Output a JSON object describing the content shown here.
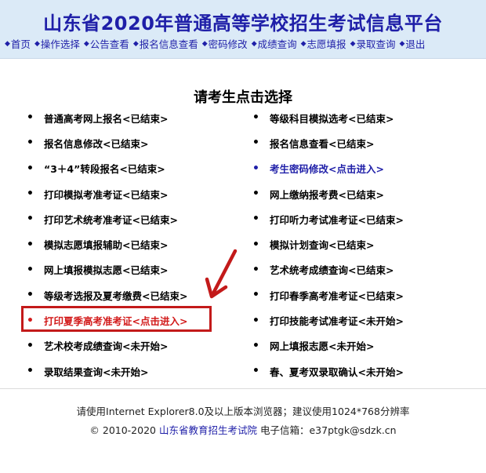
{
  "header": {
    "title": "山东省2020年普通高等学校招生考试信息平台",
    "nav": [
      "首页",
      "操作选择",
      "公告查看",
      "报名信息查看",
      "密码修改",
      "成绩查询",
      "志愿填报",
      "录取查询",
      "退出"
    ]
  },
  "main": {
    "prompt": "请考生点击选择",
    "bullet": "•",
    "left": [
      "普通高考网上报名<已结束>",
      "报名信息修改<已结束>",
      "“3＋4”转段报名<已结束>",
      "打印模拟考准考证<已结束>",
      "打印艺术统考准考证<已结束>",
      "模拟志愿填报辅助<已结束>",
      "网上填报模拟志愿<已结束>",
      "等级考选报及夏考缴费<已结束>",
      "打印夏季高考准考证<点击进入>",
      "艺术校考成绩查询<未开始>",
      "录取结果查询<未开始>"
    ],
    "right": [
      "等级科目模拟选考<已结束>",
      "报名信息查看<已结束>",
      "考生密码修改<点击进入>",
      "网上缴纳报考费<已结束>",
      "打印听力考试准考证<已结束>",
      "模拟计划查询<已结束>",
      "艺术统考成绩查询<已结束>",
      "打印春季高考准考证<已结束>",
      "打印技能考试准考证<未开始>",
      "网上填报志愿<未开始>",
      "春、夏考双录取确认<未开始>"
    ],
    "colors": {
      "link": "#1f1fa8",
      "highlight": "#d21a1a",
      "box": "#c31a1a"
    }
  },
  "footer": {
    "line1": "请使用Internet Explorer8.0及以上版本浏览器；建议使用1024*768分辨率",
    "copyright": "© 2010-2020",
    "org": "山东省教育招生考试院",
    "email": "电子信箱：e37ptgk@sdzk.cn"
  }
}
